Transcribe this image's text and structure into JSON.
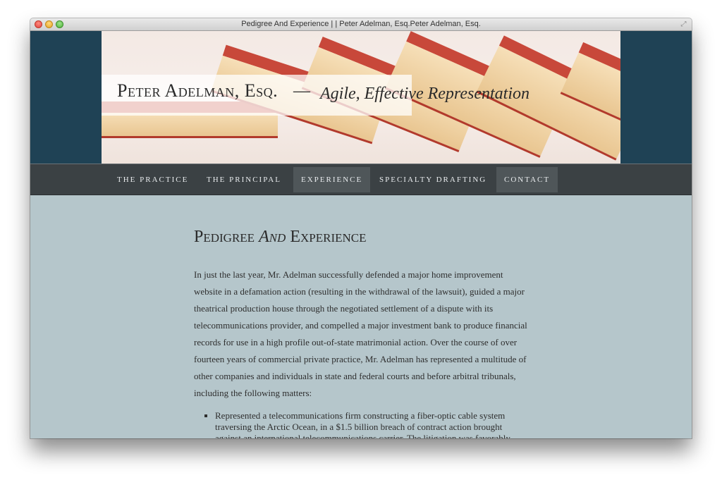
{
  "window": {
    "title": "Pedigree And Experience | | Peter Adelman, Esq.Peter Adelman, Esq."
  },
  "site": {
    "title": "Peter Adelman, Esq.",
    "separator": "—",
    "tagline": "Agile, Effective Representation"
  },
  "nav": {
    "items": [
      {
        "label": "The Practice",
        "active": false
      },
      {
        "label": "The Principal",
        "active": false
      },
      {
        "label": "Experience",
        "active": true
      },
      {
        "label": "Specialty Drafting",
        "active": false
      },
      {
        "label": "Contact",
        "active": true
      }
    ]
  },
  "page": {
    "title_pre": "Pedigree ",
    "title_em": "And",
    "title_post": " Experience",
    "intro": "In just the last year, Mr. Adelman successfully defended a major home improvement website in a defamation action (resulting in the withdrawal of the lawsuit), guided a major theatrical production house through the negotiated settlement of a dispute with its telecommunications provider, and compelled a major investment bank to produce financial records for use in a high profile out-of-state matrimonial action.  Over the course of over fourteen years of commercial private practice, Mr. Adelman has represented a multitude of other companies and individuals in state and federal courts and before arbitral tribunals, including the following matters:",
    "matters": [
      "Represented a telecommunications firm constructing a fiber-optic cable system traversing the Arctic Ocean, in a $1.5 billion breach of contract action brought against an international telecommunications carrier. The litigation was favorably"
    ]
  }
}
